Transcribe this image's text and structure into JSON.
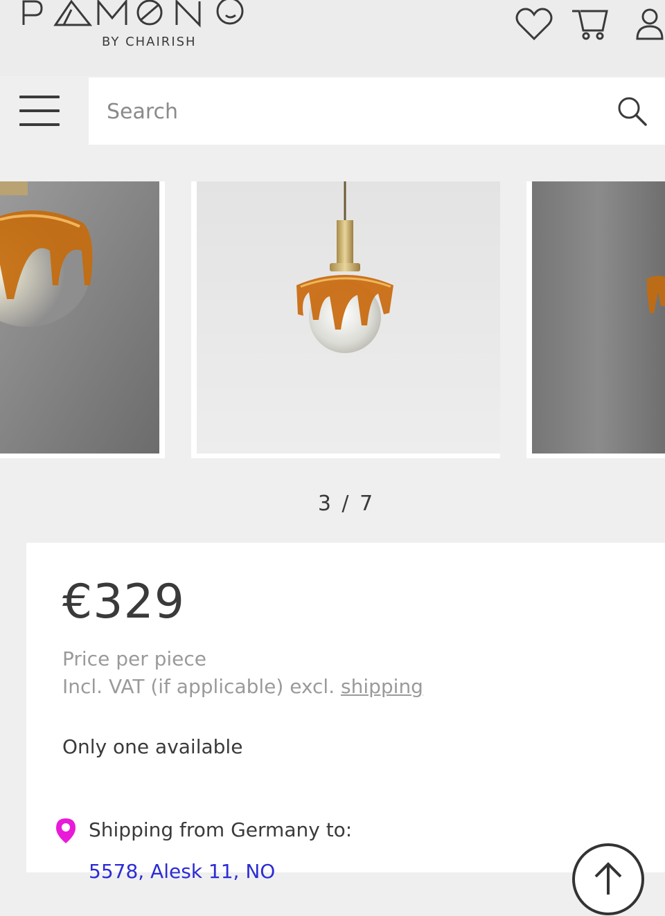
{
  "brand": {
    "logo_text": "PAMONO",
    "sub": "BY CHAIRISH"
  },
  "header": {
    "icons": [
      "heart-icon",
      "cart-icon",
      "user-icon"
    ]
  },
  "nav": {
    "menu_icon": "hamburger-menu-icon"
  },
  "search": {
    "placeholder": "Search",
    "value": "",
    "icon": "search-icon"
  },
  "gallery": {
    "counter": "3 / 7",
    "current": 3,
    "total": 7
  },
  "product": {
    "price": "€329",
    "price_per": "Price per piece",
    "vat_prefix": "Incl. VAT (if applicable) excl.",
    "shipping_link": "shipping",
    "availability": "Only one available",
    "shipping_from": "Shipping from Germany to:",
    "destination": "5578, Alesk 11, NO"
  },
  "colors": {
    "accent_pin": "#e91ad8",
    "link": "#2b2bd6",
    "text": "#3a3a3a",
    "muted": "#9a9a9a",
    "background": "#efefef"
  }
}
